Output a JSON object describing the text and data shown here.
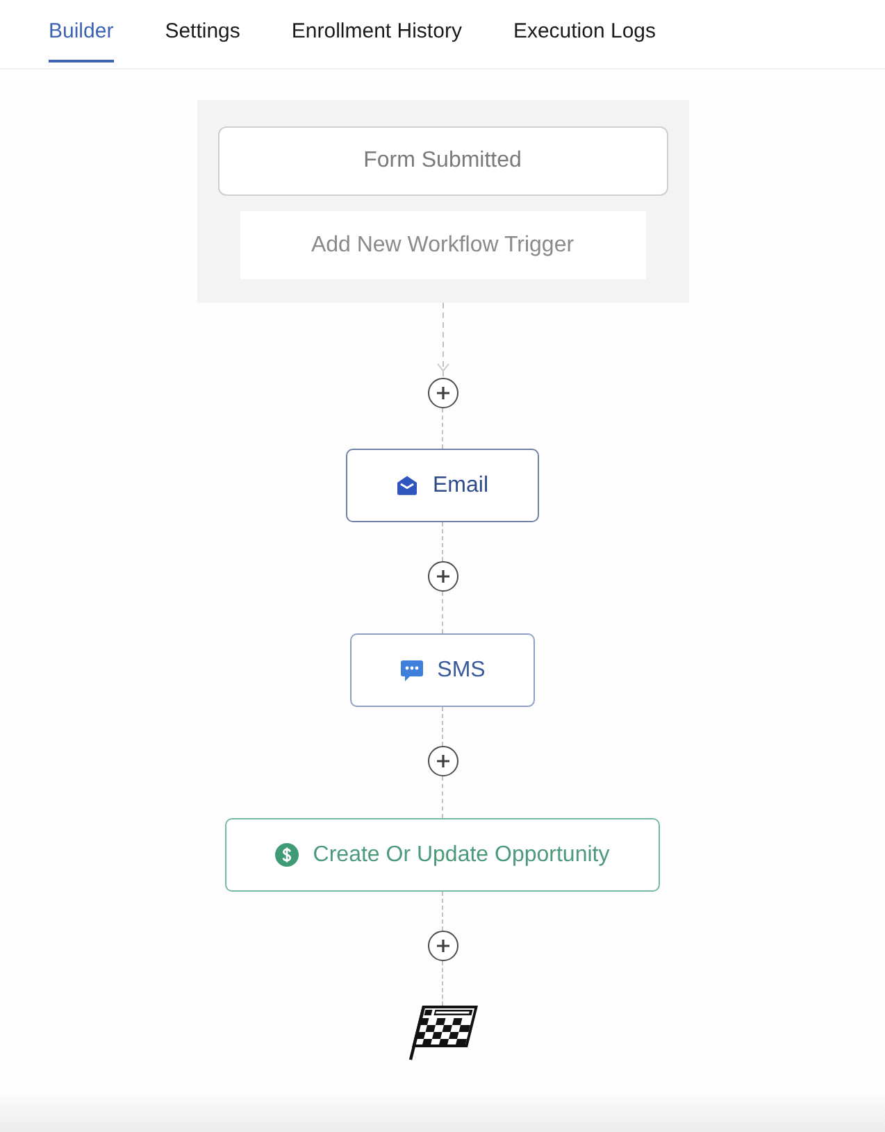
{
  "tabs": [
    {
      "label": "Builder",
      "selected": true
    },
    {
      "label": "Settings",
      "selected": false
    },
    {
      "label": "Enrollment History",
      "selected": false
    },
    {
      "label": "Execution Logs",
      "selected": false
    }
  ],
  "trigger_panel": {
    "items": [
      {
        "kind": "trigger",
        "label": "Form Submitted"
      },
      {
        "kind": "add",
        "label": "Add New Workflow Trigger"
      }
    ]
  },
  "steps": [
    {
      "kind": "email",
      "label": "Email"
    },
    {
      "kind": "sms",
      "label": "SMS"
    },
    {
      "kind": "opportunity",
      "label": "Create Or Update Opportunity"
    }
  ]
}
